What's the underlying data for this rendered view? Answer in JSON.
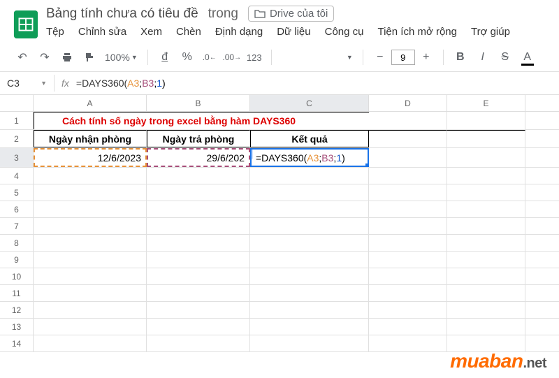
{
  "doc": {
    "title": "Bảng tính chưa có tiêu đề",
    "in_label": "trong",
    "drive_location": "Drive của tôi"
  },
  "menu": [
    "Tệp",
    "Chỉnh sửa",
    "Xem",
    "Chèn",
    "Định dạng",
    "Dữ liệu",
    "Công cụ",
    "Tiện ích mở rộng",
    "Trợ giúp"
  ],
  "toolbar": {
    "zoom": "100%",
    "currency": "đ",
    "percent": "%",
    "dec_dec": ".0",
    "dec_inc": ".00",
    "number_format": "123",
    "font_size": "9"
  },
  "namebox": "C3",
  "formula": {
    "raw": "=DAYS360(A3;B3;1)",
    "fn": "=DAYS360(",
    "ref1": "A3",
    "sep": ";",
    "ref2": "B3",
    "num": "1",
    "close": ")"
  },
  "columns": [
    "A",
    "B",
    "C",
    "D",
    "E"
  ],
  "rows": [
    "1",
    "2",
    "3",
    "4",
    "5",
    "6",
    "7",
    "8",
    "9",
    "10",
    "11",
    "12",
    "13",
    "14"
  ],
  "cells": {
    "title_text": "Cách tính số ngày trong excel bằng hàm DAYS360",
    "a2": "Ngày nhận phòng",
    "b2": "Ngày trả phòng",
    "c2": "Kết quả",
    "a3": "12/6/2023",
    "b3": "29/6/202",
    "c3": "=DAYS360(A3;B3;1)",
    "hint": "?"
  },
  "watermark": {
    "brand": "muaban",
    "suffix": ".net"
  }
}
